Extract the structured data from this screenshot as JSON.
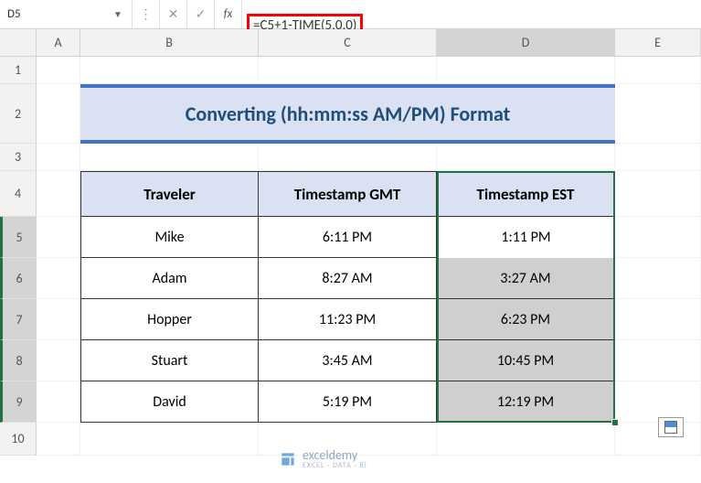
{
  "nameBox": "D5",
  "formula": "=C5+1-TIME(5,0,0)",
  "columns": [
    "A",
    "B",
    "C",
    "D",
    "E"
  ],
  "rowNumbers": [
    "1",
    "2",
    "3",
    "4",
    "5",
    "6",
    "7",
    "8",
    "9",
    "10"
  ],
  "title": "Converting (hh:mm:ss AM/PM) Format",
  "headers": {
    "c1": "Traveler",
    "c2": "Timestamp GMT",
    "c3": "Timestamp EST"
  },
  "rows": [
    {
      "traveler": "Mike",
      "gmt": "6:11 PM",
      "est": "1:11 PM"
    },
    {
      "traveler": "Adam",
      "gmt": "8:27 AM",
      "est": "3:27 AM"
    },
    {
      "traveler": "Hopper",
      "gmt": "11:23 PM",
      "est": "6:23 PM"
    },
    {
      "traveler": "Stuart",
      "gmt": "3:45 AM",
      "est": "10:45 PM"
    },
    {
      "traveler": "David",
      "gmt": "5:19 PM",
      "est": "12:19 PM"
    }
  ],
  "watermark": {
    "main": "exceldemy",
    "sub": "EXCEL · DATA · BI"
  }
}
